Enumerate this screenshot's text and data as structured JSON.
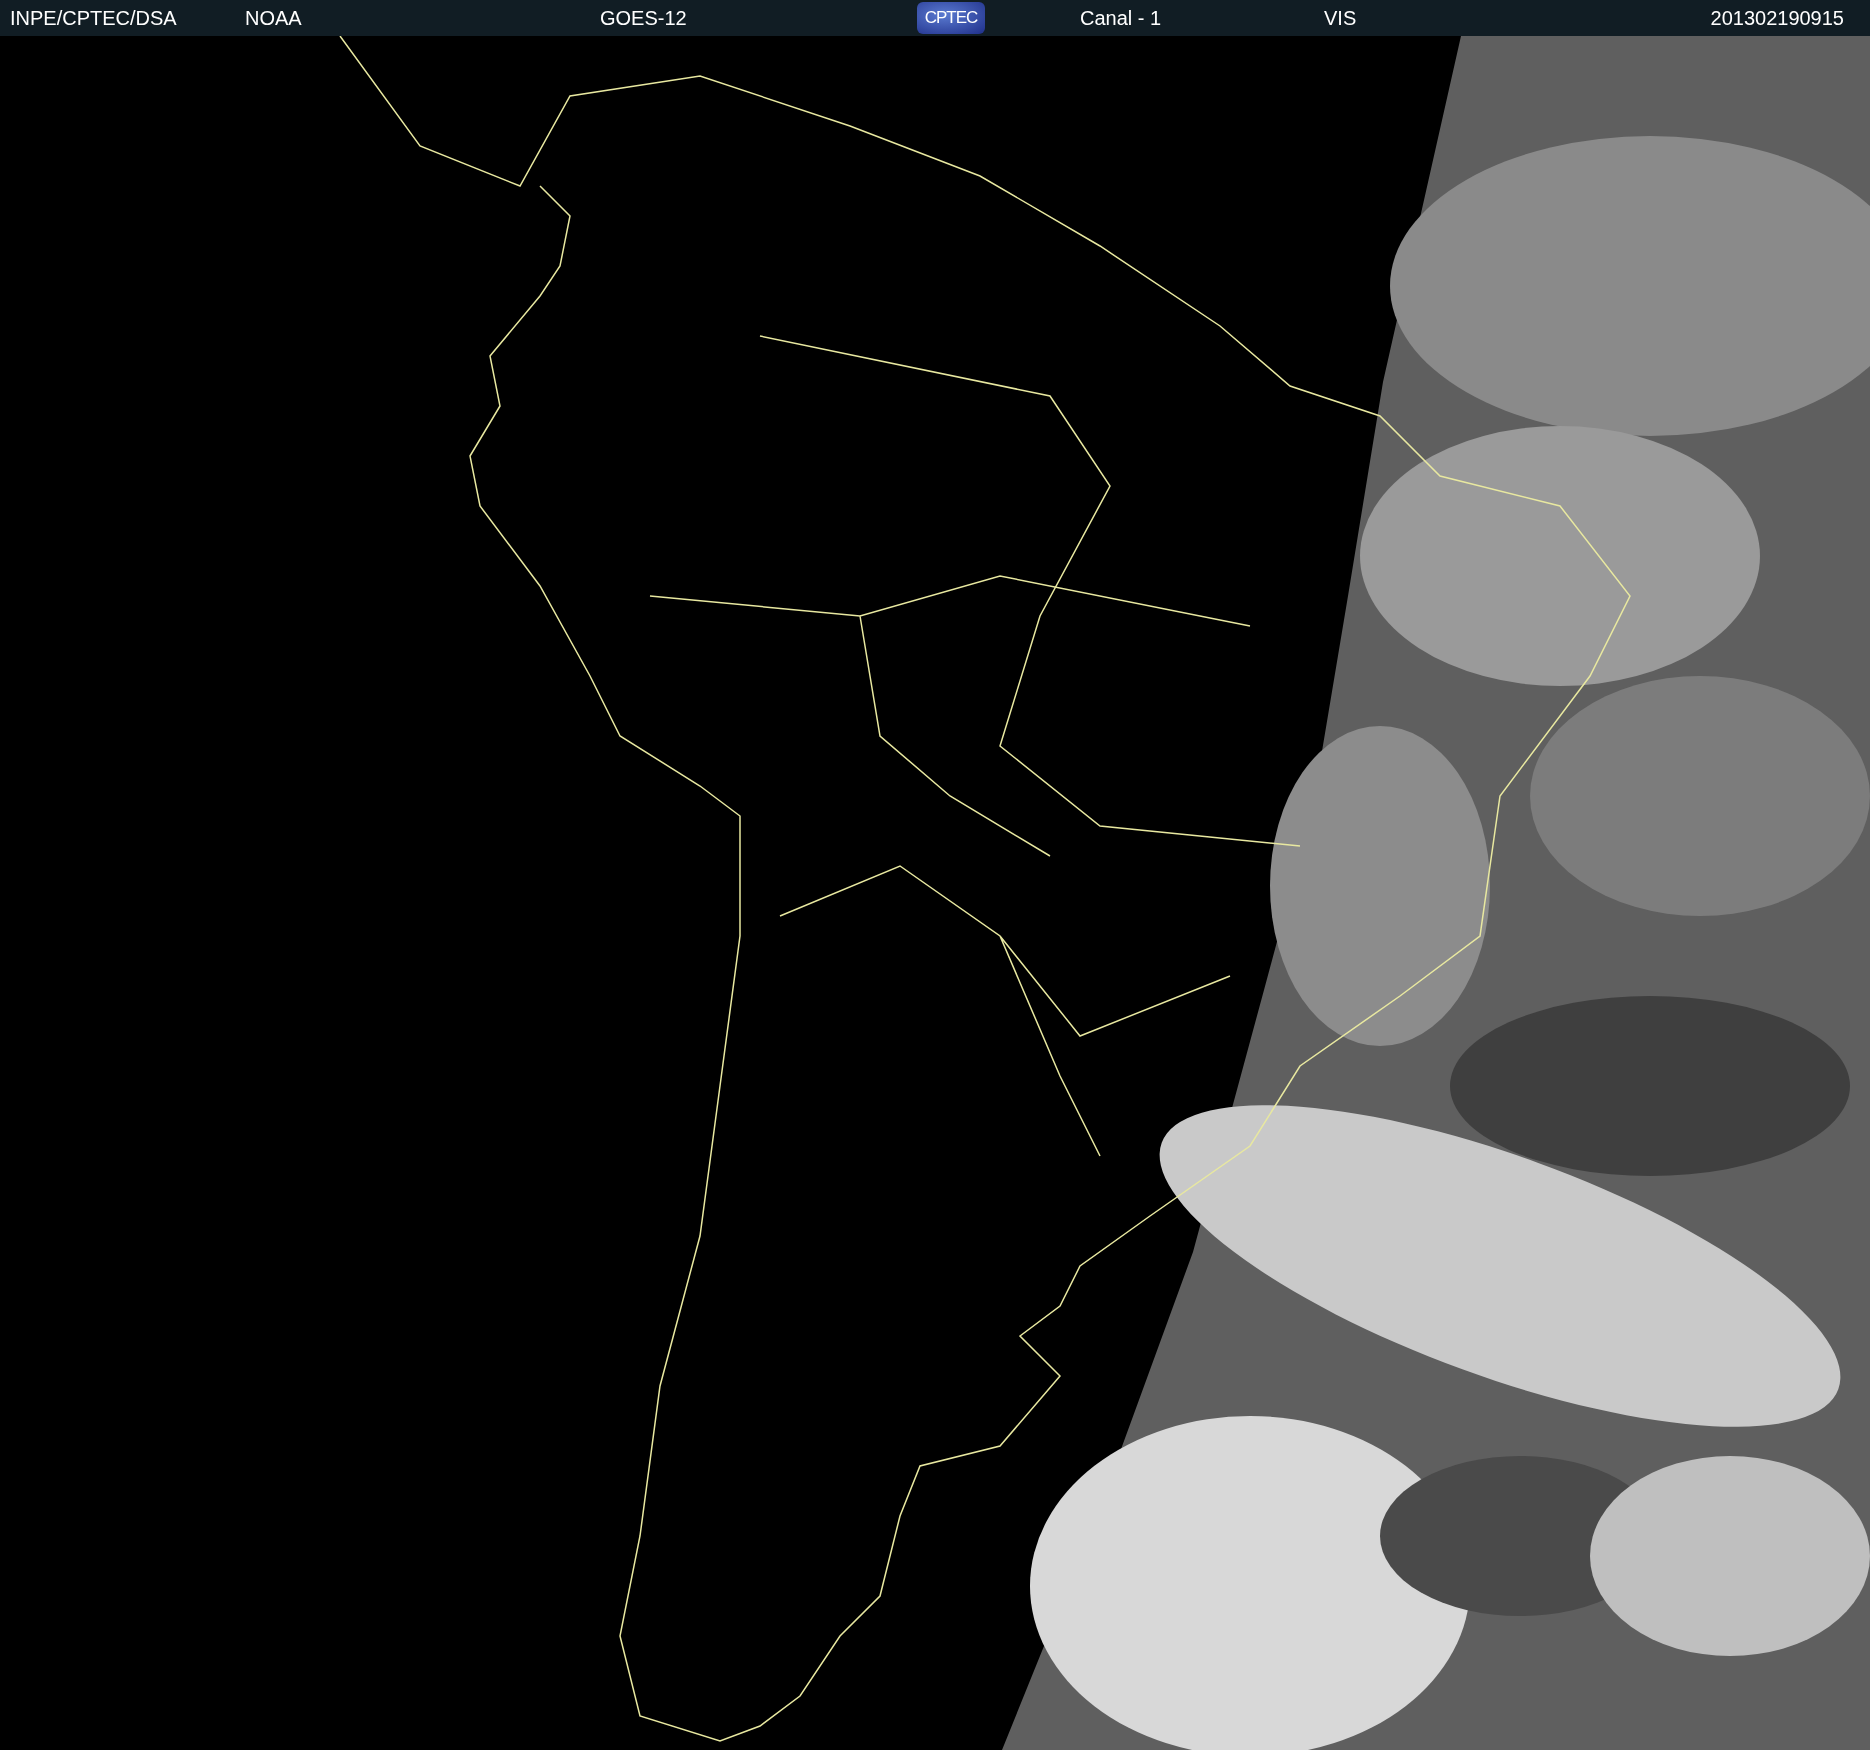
{
  "header": {
    "items": [
      {
        "kind": "text",
        "text": "INPE/CPTEC/DSA"
      },
      {
        "kind": "text",
        "text": "NOAA"
      },
      {
        "kind": "text",
        "text": "GOES-12"
      },
      {
        "kind": "logo",
        "text": "CPTEC"
      },
      {
        "kind": "text",
        "text": "Canal - 1"
      },
      {
        "kind": "text",
        "text": "VIS"
      },
      {
        "kind": "text",
        "text": "201302190915"
      }
    ]
  }
}
